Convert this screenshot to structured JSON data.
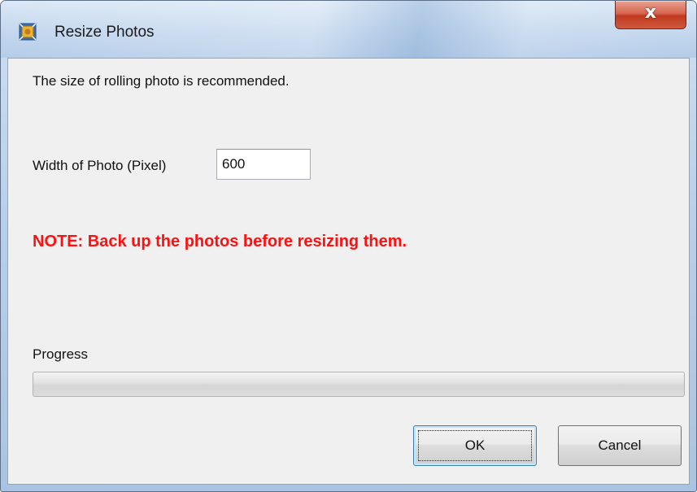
{
  "window": {
    "title": "Resize Photos",
    "icon": "resize-photos-app-icon",
    "close_glyph": "x",
    "close_icon": "close-icon"
  },
  "content": {
    "message": "The size of rolling photo is recommended.",
    "width_label": "Width of Photo (Pixel)",
    "width_value": "600",
    "note": "NOTE: Back up the photos before resizing them.",
    "note_color": "#ff1010",
    "progress_label": "Progress",
    "progress_value": 0
  },
  "buttons": {
    "ok_label": "OK",
    "cancel_label": "Cancel"
  }
}
